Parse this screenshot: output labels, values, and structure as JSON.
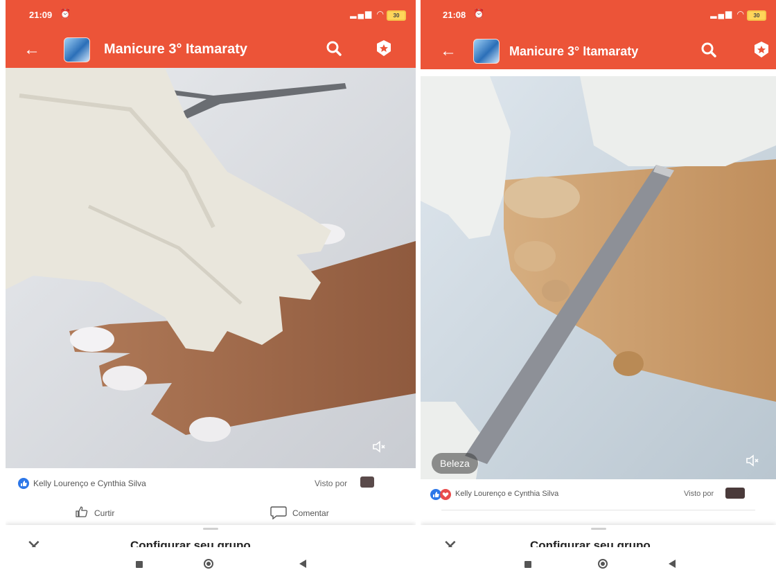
{
  "left": {
    "status": {
      "time": "21:09",
      "alarm": "⏰",
      "battery": "30"
    },
    "appbar": {
      "title": "Manicure 3° Itamaraty"
    },
    "reactions": {
      "names": "Kelly Lourenço e Cynthia Silva",
      "seen": "Visto por"
    },
    "actions": {
      "like": "Curtir",
      "comment": "Comentar"
    },
    "sheet": {
      "title": "Configurar seu grupo"
    }
  },
  "right": {
    "status": {
      "time": "21:08",
      "alarm": "⏰",
      "battery": "30"
    },
    "appbar": {
      "title": "Manicure 3° Itamaraty"
    },
    "badge": "Beleza",
    "reactions": {
      "names": "Kelly Lourenço e Cynthia Silva",
      "seen": "Visto por"
    },
    "sheet": {
      "title": "Configurar seu grupo"
    }
  },
  "colors": {
    "brand": "#ec5438",
    "like": "#2d77e8",
    "love": "#e94c4c"
  },
  "icons": [
    "back-arrow-icon",
    "search-icon",
    "star-badge-icon",
    "volume-icon",
    "thumbs-up-icon",
    "comment-icon",
    "close-icon"
  ]
}
